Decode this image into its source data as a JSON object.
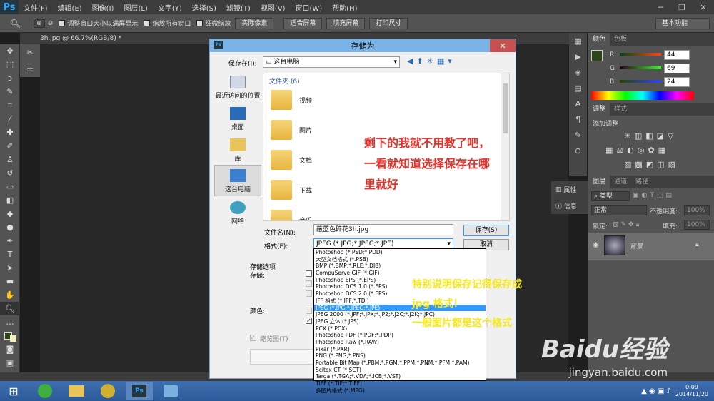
{
  "app": {
    "logo": "Ps"
  },
  "menu": [
    "文件(F)",
    "编辑(E)",
    "图像(I)",
    "图层(L)",
    "文字(Y)",
    "选择(S)",
    "滤镜(T)",
    "视图(V)",
    "窗口(W)",
    "帮助(H)"
  ],
  "options": {
    "chk1": "调整窗口大小以满屏显示",
    "chk2": "缩放所有窗口",
    "chk3": "细微缩放",
    "btn1": "实际像素",
    "btn2": "适合屏幕",
    "btn3": "填充屏幕",
    "btn4": "打印尺寸",
    "workspace": "基本功能"
  },
  "doc_tab": "3h.jpg @ 66.7%(RGB/8) *",
  "dialog": {
    "title": "存储为",
    "save_in_label": "保存在(I):",
    "save_in_value": "这台电脑",
    "places": [
      "最近访问的位置",
      "桌面",
      "库",
      "这台电脑",
      "网络"
    ],
    "folder_header": "文件夹 (6)",
    "folders": [
      "视频",
      "图片",
      "文档",
      "下载",
      "音乐"
    ],
    "filename_label": "文件名(N):",
    "filename_value": "蔽蓝色碎花3h.jpg",
    "format_label": "格式(F):",
    "format_value": "JPEG (*.JPG;*.JPEG;*.JPE)",
    "save_btn": "保存(S)",
    "cancel_btn": "取消",
    "options_title": "存储选项",
    "store_label": "存储:",
    "color_label": "颜色:",
    "thumbnail_label": "缩览图(T)"
  },
  "formats": [
    "Photoshop (*.PSD;*.PDD)",
    "大型文档格式 (*.PSB)",
    "BMP (*.BMP;*.RLE;*.DIB)",
    "CompuServe GIF (*.GIF)",
    "Photoshop EPS (*.EPS)",
    "Photoshop DCS 1.0 (*.EPS)",
    "Photoshop DCS 2.0 (*.EPS)",
    "IFF 格式 (*.IFF;*.TDI)",
    "JPEG (*.JPG;*.JPEG;*.JPE)",
    "JPEG 2000 (*.JPF;*.JPX;*.JP2;*.J2C;*.J2K;*.JPC)",
    "JPEG 立体 (*.JPS)",
    "PCX (*.PCX)",
    "Photoshop PDF (*.PDF;*.PDP)",
    "Photoshop Raw (*.RAW)",
    "Pixar (*.PXR)",
    "PNG (*.PNG;*.PNS)",
    "Portable Bit Map (*.PBM;*.PGM;*.PPM;*.PNM;*.PFM;*.PAM)",
    "Scitex CT (*.SCT)",
    "Targa (*.TGA;*.VDA;*.ICB;*.VST)",
    "TIFF (*.TIF;*.TIFF)",
    "多图片格式 (*.MPO)"
  ],
  "selected_format_index": 8,
  "notes": {
    "red": [
      "剩下的我就不用教了吧，",
      "一看就知道选择保存在哪",
      "里就好"
    ],
    "yellow": [
      "特别说明保存记得保存成",
      "jpg 格式！",
      "一般图片都是这个格式"
    ],
    "red_color": "#e8332a",
    "yellow_color": "#f7e81b"
  },
  "color_panel": {
    "tabs": [
      "颜色",
      "色板"
    ],
    "r_label": "R",
    "g_label": "G",
    "b_label": "B",
    "r": "44",
    "g": "69",
    "b": "24"
  },
  "adjust_panel": {
    "tabs": [
      "调整",
      "样式"
    ],
    "title": "添加调整"
  },
  "info": {
    "props": "属性",
    "info": "信息"
  },
  "layers": {
    "tabs": [
      "图层",
      "通道",
      "路径"
    ],
    "kind": "类型",
    "mode": "正常",
    "opacity_label": "不透明度:",
    "opacity": "100%",
    "lock_label": "锁定:",
    "fill_label": "填充:",
    "fill": "100%",
    "layer_name": "背景"
  },
  "taskbar": {
    "time": "0:09",
    "date": "2014/11/20"
  },
  "watermark": {
    "brand": "Baidu经验",
    "url": "jingyan.baidu.com"
  }
}
